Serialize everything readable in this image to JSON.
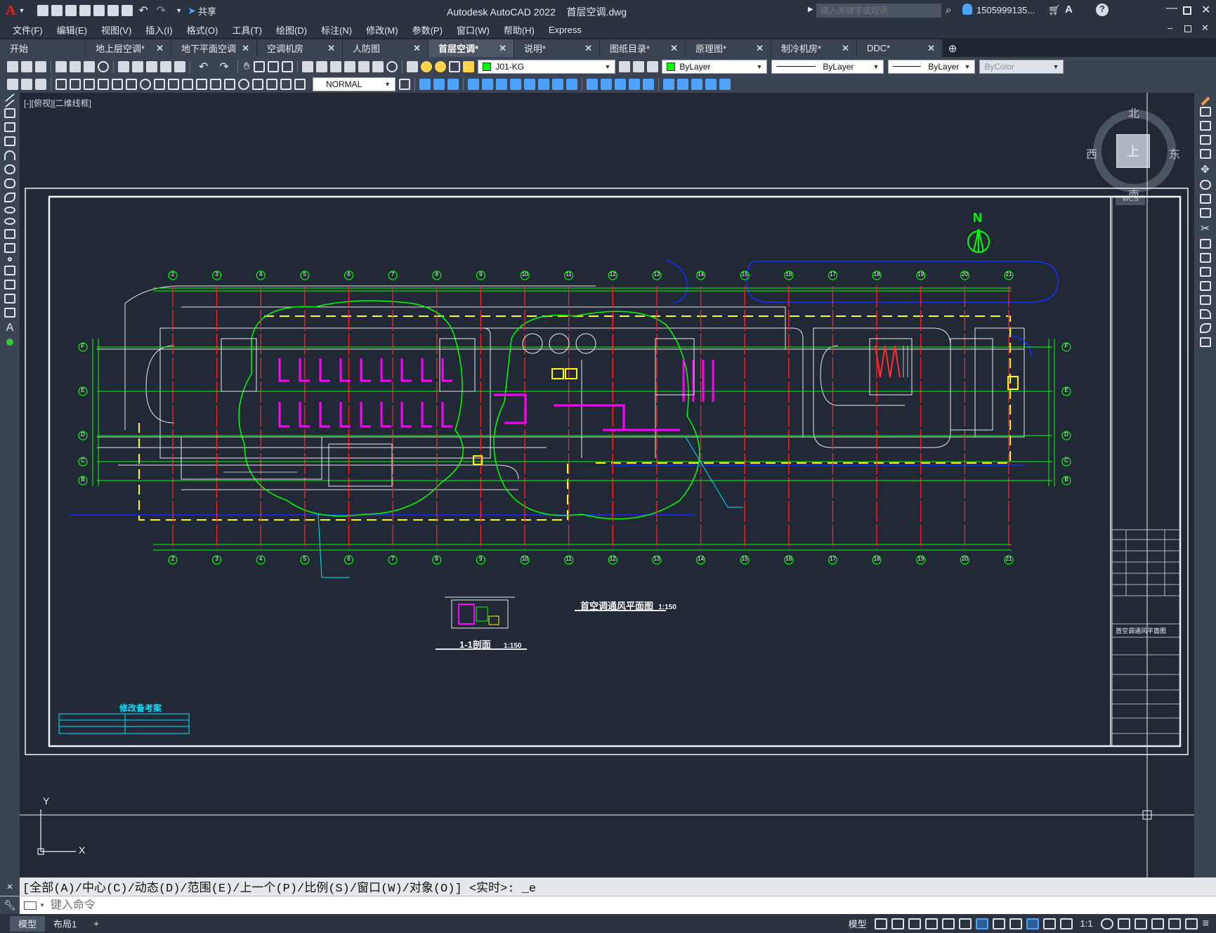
{
  "app": {
    "logo_letter": "A",
    "title": "Autodesk AutoCAD 2022",
    "filename": "首层空调.dwg",
    "share_label": "共享",
    "search_placeholder": "键入关键字或短语",
    "user": "1505999135...",
    "help": "?"
  },
  "menu": [
    "文件(F)",
    "编辑(E)",
    "视图(V)",
    "插入(I)",
    "格式(O)",
    "工具(T)",
    "绘图(D)",
    "标注(N)",
    "修改(M)",
    "参数(P)",
    "窗口(W)",
    "帮助(H)",
    "Express"
  ],
  "tabs": [
    "开始",
    "地上层空调*",
    "地下平面空调",
    "空调机房",
    "人防图",
    "首层空调*",
    "说明*",
    "图纸目录*",
    "原理图*",
    "制冷机房*",
    "DDC*"
  ],
  "active_tab": 5,
  "toolbar": {
    "layer": "J01-KG",
    "color": "ByLayer",
    "linetype": "ByLayer",
    "lineweight": "ByLayer",
    "plotstyle": "ByColor",
    "text_style": "NORMAL"
  },
  "viewport": {
    "label": "[-][俯视][二维线框]",
    "compass": {
      "north": "北",
      "south": "南",
      "east": "东",
      "west": "西",
      "center": "上"
    },
    "wcs": "WCS",
    "ucs_x": "X",
    "ucs_y": "Y"
  },
  "drawing": {
    "north_label": "N",
    "main_title": "首空调通风平面图",
    "main_scale": "1:150",
    "section_title": "1-1剖面",
    "section_scale": "1:150",
    "revision_title": "修改备考案",
    "titleblock_name": "首空调通风平面图",
    "grid_top": [
      "2",
      "3",
      "4",
      "5",
      "6",
      "7",
      "8",
      "9",
      "10",
      "11",
      "12",
      "13",
      "14",
      "15",
      "16",
      "17",
      "18",
      "19",
      "20",
      "21"
    ],
    "grid_left": [
      "F",
      "E",
      "D",
      "C",
      "B"
    ],
    "grid_right": [
      "F",
      "E",
      "D",
      "C",
      "B"
    ],
    "grid_bottom": [
      "2",
      "3",
      "4",
      "5",
      "6",
      "7",
      "8",
      "9",
      "10",
      "11",
      "12",
      "13",
      "14",
      "15",
      "16",
      "17",
      "18",
      "19",
      "20",
      "21"
    ],
    "accent_green": "#00ff00",
    "accent_red": "#ff2020",
    "accent_magenta": "#ff00ff",
    "accent_yellow": "#ffff00",
    "accent_blue": "#1030ff",
    "accent_cyan": "#00e5ff"
  },
  "command": {
    "history": "[全部(A)/中心(C)/动态(D)/范围(E)/上一个(P)/比例(S)/窗口(W)/对象(O)] <实时>: _e",
    "placeholder": "键入命令"
  },
  "status": {
    "layout_tabs": [
      "模型",
      "布局1"
    ],
    "add_tab": "+",
    "model_label": "模型",
    "scale": "1:1"
  }
}
